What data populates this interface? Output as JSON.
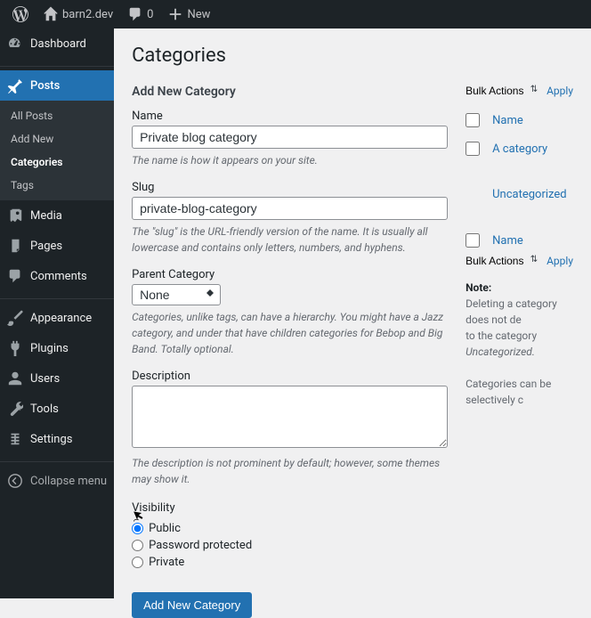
{
  "toolbar": {
    "site_name": "barn2.dev",
    "comments_count": "0",
    "new_label": "New"
  },
  "sidebar": {
    "dashboard": "Dashboard",
    "posts": "Posts",
    "posts_sub": {
      "all": "All Posts",
      "add": "Add New",
      "categories": "Categories",
      "tags": "Tags"
    },
    "media": "Media",
    "pages": "Pages",
    "comments": "Comments",
    "appearance": "Appearance",
    "plugins": "Plugins",
    "users": "Users",
    "tools": "Tools",
    "settings": "Settings",
    "collapse": "Collapse menu"
  },
  "page": {
    "title": "Categories",
    "form_title": "Add New Category",
    "name_label": "Name",
    "name_value": "Private blog category",
    "name_desc": "The name is how it appears on your site.",
    "slug_label": "Slug",
    "slug_value": "private-blog-category",
    "slug_desc": "The \"slug\" is the URL-friendly version of the name. It is usually all lowercase and contains only letters, numbers, and hyphens.",
    "parent_label": "Parent Category",
    "parent_value": "None",
    "parent_desc": "Categories, unlike tags, can have a hierarchy. You might have a Jazz category, and under that have children categories for Bebop and Big Band. Totally optional.",
    "desc_label": "Description",
    "desc_value": "",
    "desc_desc": "The description is not prominent by default; however, some themes may show it.",
    "visibility_label": "Visibility",
    "vis_public": "Public",
    "vis_password": "Password protected",
    "vis_private": "Private",
    "submit": "Add New Category"
  },
  "table": {
    "bulk_label": "Bulk Actions",
    "apply": "Apply",
    "header_name": "Name",
    "rows": [
      {
        "name": "A category"
      },
      {
        "name": "Uncategorized"
      }
    ],
    "note_title": "Note:",
    "note_1a": "Deleting a category does not de",
    "note_1b": "to the category ",
    "note_1c": "Uncategorized.",
    "note_2": "Categories can be selectively c"
  }
}
